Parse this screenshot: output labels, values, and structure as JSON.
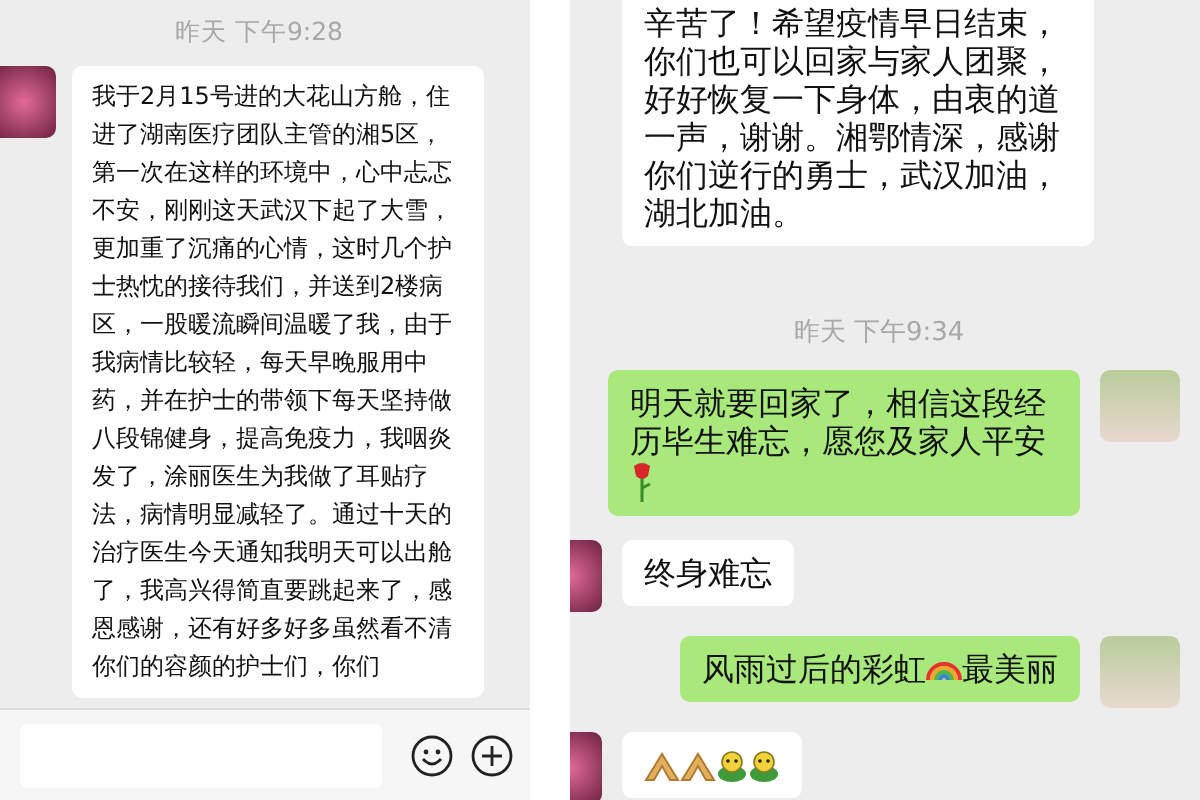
{
  "panels": [
    {
      "items": [
        {
          "kind": "time",
          "text": "昨天 下午9:28"
        },
        {
          "kind": "incoming",
          "avatar": true,
          "parts": [
            {
              "kind": "text",
              "text": "我于2月15号进的大花山方舱，住进了湖南医疗团队主管的湘5区，第一次在这样的环境中，心中忐忑不安，刚刚这天武汉下起了大雪，更加重了沉痛的心情，这时几个护士热忱的接待我们，并送到2楼病区，一股暖流瞬间温暖了我，由于我病情比较轻，每天早晚服用中药，并在护士的带领下每天坚持做八段锦健身，提高免疫力，我咽炎发了，涂丽医生为我做了耳贴疗法，病情明显减轻了。通过十天的治疗医生今天通知我明天可以出舱了，我高兴得简直要跳起来了，感恩感谢，还有好多好多虽然看不清你们的容颜的护士们，你们"
            }
          ]
        }
      ],
      "input_bar": true
    },
    {
      "items": [
        {
          "kind": "incoming",
          "avatar": false,
          "parts": [
            {
              "kind": "text",
              "text": "辛苦了！希望疫情早日结束，你们也可以回家与家人团聚，好好恢复一下身体，由衷的道一声，谢谢。湘鄂情深，感谢你们逆行的勇士，武汉加油，湖北加油。"
            }
          ]
        },
        {
          "kind": "time",
          "text": "昨天 下午9:34"
        },
        {
          "kind": "outgoing",
          "avatar": true,
          "parts": [
            {
              "kind": "text",
              "text": "明天就要回家了，相信这段经历毕生难忘，愿您及家人平安"
            },
            {
              "kind": "rose"
            }
          ]
        },
        {
          "kind": "incoming",
          "avatar": true,
          "parts": [
            {
              "kind": "text",
              "text": "终身难忘"
            }
          ]
        },
        {
          "kind": "outgoing",
          "avatar": true,
          "parts": [
            {
              "kind": "text",
              "text": "风雨过后的彩虹"
            },
            {
              "kind": "rainbow"
            },
            {
              "kind": "text",
              "text": "最美丽"
            }
          ]
        },
        {
          "kind": "incoming",
          "avatar": true,
          "parts": [
            {
              "kind": "hands"
            },
            {
              "kind": "hands"
            },
            {
              "kind": "frog"
            },
            {
              "kind": "frog"
            }
          ]
        }
      ],
      "input_bar": false
    }
  ]
}
